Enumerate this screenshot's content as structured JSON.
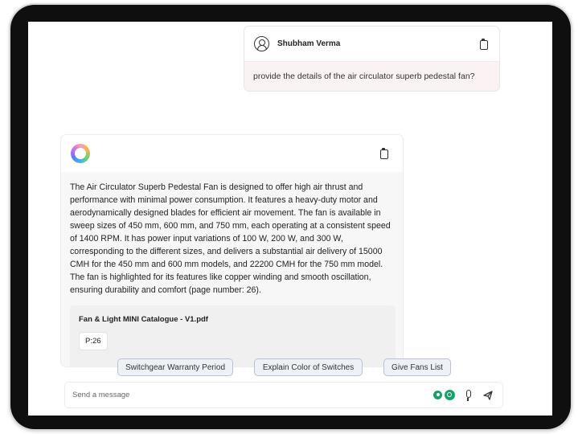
{
  "user_message": {
    "name": "Shubham Verma",
    "text": "provide the details of the air circulator superb pedestal fan?",
    "copy_icon": "clipboard-icon"
  },
  "assistant_message": {
    "logo_icon": "gradient-ring-logo",
    "copy_icon": "clipboard-icon",
    "text": "The Air Circulator Superb Pedestal Fan is designed to offer high air thrust and performance with minimal power consumption. It features a heavy-duty motor and aerodynamically designed blades for efficient air movement. The fan is available in sweep sizes of 450 mm, 600 mm, and 750 mm, each operating at a consistent speed of 1400 RPM. It has power input variations of 100 W, 200 W, and 300 W, corresponding to the different sizes, and delivers a substantial air delivery of 15000 CMH for the 450 mm and 600 mm models, and 22200 CMH for the 750 mm model. The fan is highlighted for its features like copper winding and smooth oscillation, ensuring durability and comfort (page number: 26).",
    "source": {
      "title": "Fan & Light MINI Catalogue - V1.pdf",
      "page": "P:26"
    }
  },
  "suggestions": [
    "Switchgear Warranty Period",
    "Explain Color of Switches",
    "Give Fans List"
  ],
  "composer": {
    "placeholder": "Send a message",
    "icons": [
      "grammarly-icon",
      "grammar-check-icon",
      "microphone-icon",
      "send-icon"
    ]
  },
  "colors": {
    "bezel": "#0f0f0f",
    "user_bubble": "#fbf3f3",
    "assistant_body": "#f7f7f7",
    "chip_bg": "#eef2f8",
    "chip_border": "#b8c1cf",
    "accent_green": "#13a36a"
  }
}
